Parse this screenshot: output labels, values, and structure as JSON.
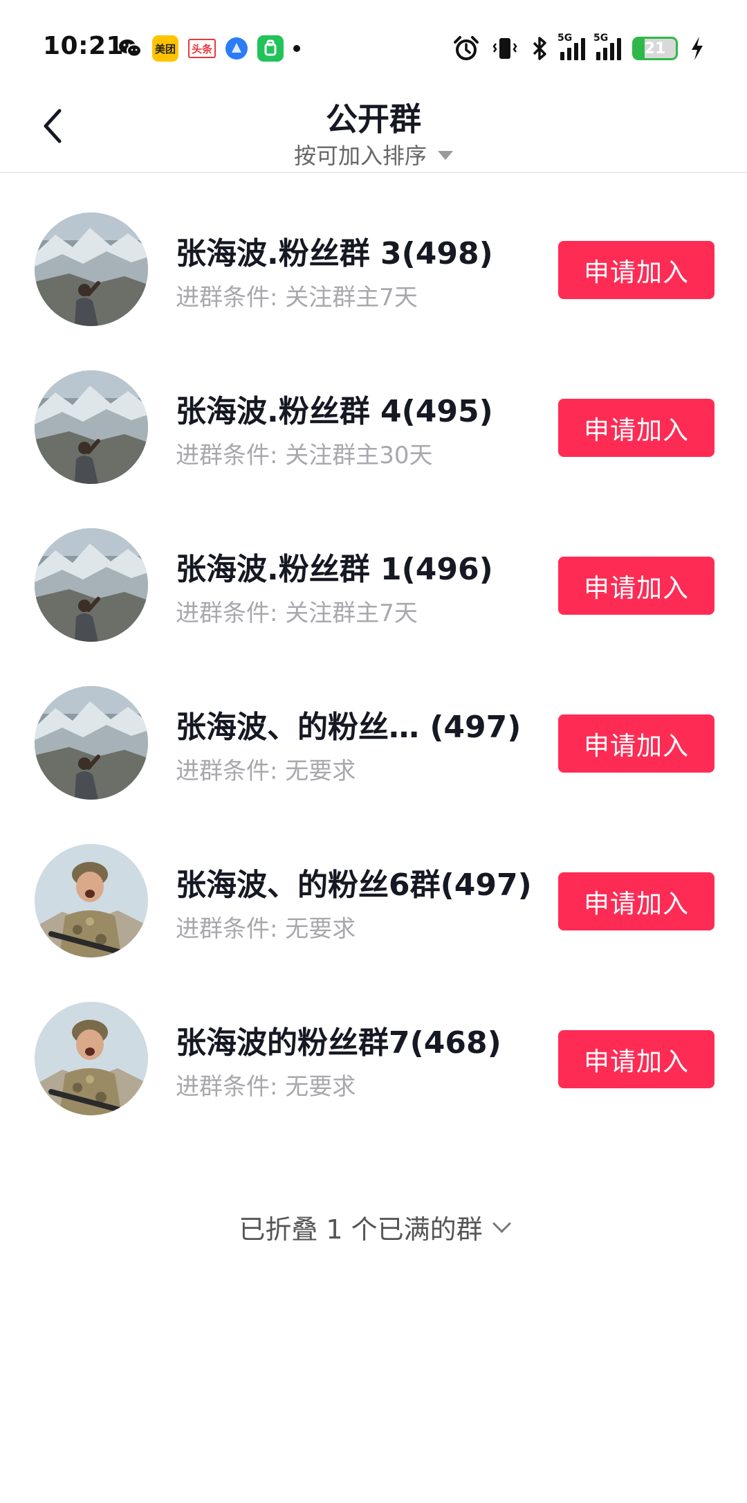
{
  "status_bar": {
    "time": "10:21",
    "left_icons": [
      "wechat-icon",
      "meituan-icon",
      "toutiao-icon",
      "blue-app-icon",
      "green-app-icon",
      "dot-icon"
    ],
    "meituan_label": "美团",
    "toutiao_label": "头条",
    "signal_1_label": "5G",
    "signal_2_label": "5G",
    "battery_level": "21",
    "right_icons": [
      "alarm-icon",
      "vibrate-icon",
      "bluetooth-icon",
      "signal-icon",
      "signal-icon",
      "battery-icon",
      "charging-icon"
    ]
  },
  "header": {
    "title": "公开群",
    "sort_label": "按可加入排序",
    "back_icon": "chevron-left-icon"
  },
  "groups": [
    {
      "name": "张海波.粉丝群 3(498)",
      "condition": "进群条件: 关注群主7天",
      "button": "申请加入",
      "avatar": "mountain-avatar"
    },
    {
      "name": "张海波.粉丝群 4(495)",
      "condition": "进群条件: 关注群主30天",
      "button": "申请加入",
      "avatar": "mountain-avatar"
    },
    {
      "name": "张海波.粉丝群 1(496)",
      "condition": "进群条件: 关注群主7天",
      "button": "申请加入",
      "avatar": "mountain-avatar"
    },
    {
      "name": "张海波、的粉丝… (497)",
      "condition": "进群条件: 无要求",
      "button": "申请加入",
      "avatar": "mountain-avatar"
    },
    {
      "name": "张海波、的粉丝6群(497)",
      "condition": "进群条件: 无要求",
      "button": "申请加入",
      "avatar": "soldier-avatar"
    },
    {
      "name": "张海波的粉丝群7(468)",
      "condition": "进群条件: 无要求",
      "button": "申请加入",
      "avatar": "soldier-avatar"
    }
  ],
  "footer": {
    "collapsed_text": "已折叠 1 个已满的群"
  },
  "colors": {
    "accent": "#fe2c55",
    "title_text": "#161823",
    "secondary_text": "#a8a8ad",
    "battery_green": "#2fb84a"
  }
}
